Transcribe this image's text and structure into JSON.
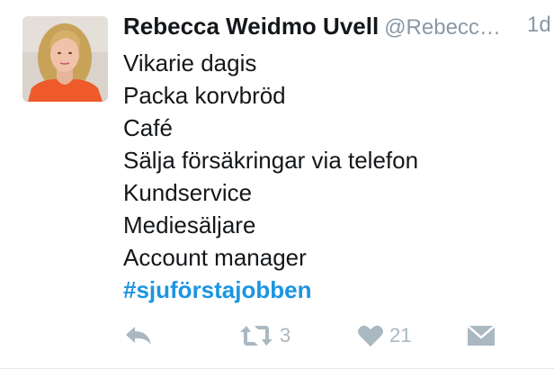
{
  "tweet": {
    "name": "Rebecca Weidmo Uvell",
    "handle": "@Rebecc…",
    "time": "1d",
    "lines": [
      "Vikarie dagis",
      "Packa korvbröd",
      "Café",
      "Sälja försäkringar via telefon",
      "Kundservice",
      "Mediesäljare",
      "Account manager"
    ],
    "hashtag": "#sjuförstajobben"
  },
  "actions": {
    "retweet_count": "3",
    "like_count": "21"
  },
  "icons": {
    "reply": "reply-icon",
    "retweet": "retweet-icon",
    "like": "heart-icon",
    "dm": "envelope-icon"
  },
  "colors": {
    "text": "#14171a",
    "muted": "#8899a6",
    "action": "#aab8c2",
    "hashtag": "#1b95e0"
  }
}
